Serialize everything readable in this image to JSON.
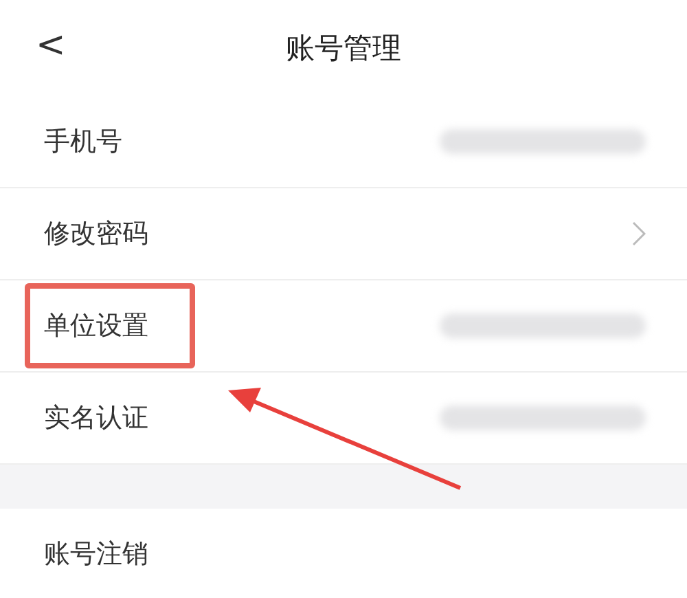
{
  "header": {
    "back": "<",
    "title": "账号管理"
  },
  "groups": [
    {
      "rows": [
        {
          "label": "手机号",
          "kind": "blurred",
          "highlighted": false
        },
        {
          "label": "修改密码",
          "kind": "chevron",
          "highlighted": false
        },
        {
          "label": "单位设置",
          "kind": "blurred",
          "highlighted": true
        },
        {
          "label": "实名认证",
          "kind": "blurred",
          "highlighted": false
        }
      ]
    },
    {
      "rows": [
        {
          "label": "账号注销",
          "kind": "plain",
          "highlighted": false
        }
      ]
    }
  ],
  "annotation": {
    "kind": "arrow"
  }
}
